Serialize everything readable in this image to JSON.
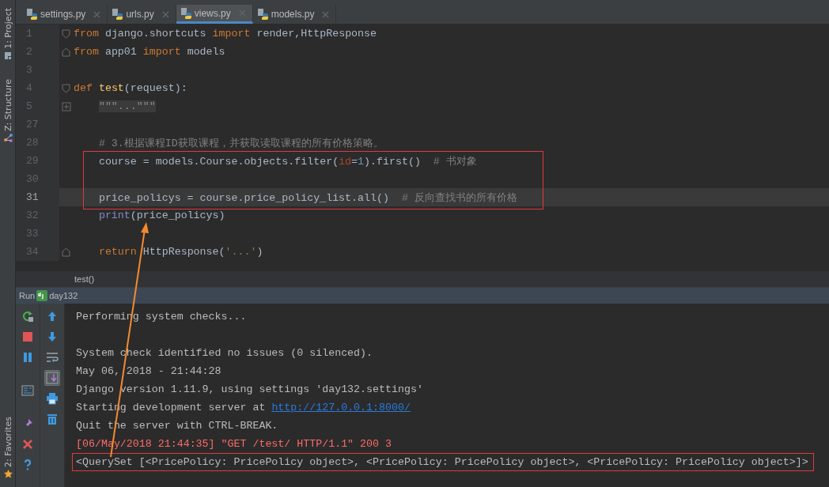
{
  "left_strip": [
    {
      "label": "1: Project",
      "kind": "project"
    },
    {
      "label": "Z: Structure",
      "kind": "structure"
    },
    {
      "label": "2: Favorites",
      "kind": "favorites"
    }
  ],
  "tabs": [
    {
      "label": "settings.py",
      "selected": false
    },
    {
      "label": "urls.py",
      "selected": false
    },
    {
      "label": "views.py",
      "selected": true
    },
    {
      "label": "models.py",
      "selected": false
    }
  ],
  "editor": {
    "lines": [
      {
        "number": "1",
        "kind": "fold-start",
        "tokens": [
          {
            "text": "from",
            "kind": "kw"
          },
          {
            "text": " django.shortcuts ",
            "kind": "plain"
          },
          {
            "text": "import",
            "kind": "kw"
          },
          {
            "text": " render,HttpResponse",
            "kind": "plain"
          }
        ]
      },
      {
        "number": "2",
        "kind": "fold-end",
        "tokens": [
          {
            "text": "from",
            "kind": "kw"
          },
          {
            "text": " app01 ",
            "kind": "plain"
          },
          {
            "text": "import",
            "kind": "kw"
          },
          {
            "text": " models",
            "kind": "plain"
          }
        ]
      },
      {
        "number": "3",
        "kind": "plain"
      },
      {
        "number": "4",
        "kind": "fold-start",
        "tokens": [
          {
            "text": "def",
            "kind": "kw"
          },
          {
            "text": " test",
            "kind": "fn"
          },
          {
            "text": "(request):",
            "kind": "plain"
          }
        ],
        "children": [
          {
            "number": "5",
            "kind": "folded",
            "tokens": [
              {
                "text": "\"\"\"...\"\"\"",
                "kind": "folded"
              }
            ]
          },
          {
            "number": "27",
            "kind": "plain"
          },
          {
            "number": "28",
            "kind": "plain",
            "tokens": [
              {
                "text": "# 3.根据课程ID获取课程，并获取读取课程的所有价格策略。",
                "kind": "comment"
              }
            ]
          },
          {
            "number": "29",
            "kind": "plain",
            "tokens": [
              {
                "text": "course = models.Course.objects.filter(",
                "kind": "plain"
              },
              {
                "text": "id",
                "kind": "param"
              },
              {
                "text": "=",
                "kind": "plain"
              },
              {
                "text": "1",
                "kind": "num"
              },
              {
                "text": ").first()  ",
                "kind": "plain"
              },
              {
                "text": "# 书对象",
                "kind": "comment"
              }
            ]
          },
          {
            "number": "30",
            "kind": "plain"
          },
          {
            "number": "31",
            "kind": "plain",
            "current": true,
            "tokens": [
              {
                "text": "price_policys = course.price_policy_list.all()  ",
                "kind": "plain"
              },
              {
                "text": "# 反向查找书的所有价格",
                "kind": "comment"
              }
            ]
          },
          {
            "number": "32",
            "kind": "plain",
            "tokens": [
              {
                "text": "print",
                "kind": "builtin"
              },
              {
                "text": "(price_policys)",
                "kind": "plain"
              }
            ]
          },
          {
            "number": "33",
            "kind": "plain"
          },
          {
            "number": "34",
            "kind": "fold-end",
            "tokens": [
              {
                "text": "return",
                "kind": "kw"
              },
              {
                "text": " HttpResponse(",
                "kind": "plain"
              },
              {
                "text": "'...'",
                "kind": "str"
              },
              {
                "text": ")",
                "kind": "plain"
              }
            ]
          }
        ]
      }
    ]
  },
  "breadcrumb": "test()",
  "run": {
    "label": "Run",
    "config": "day132",
    "tools_left": [
      {
        "kind": "rerun"
      },
      {
        "kind": "stop"
      },
      {
        "kind": "pause"
      },
      {
        "kind": "layout"
      },
      {
        "kind": "pin"
      },
      {
        "kind": "close"
      },
      {
        "kind": "help"
      }
    ],
    "tools_right": [
      {
        "kind": "up",
        "selected": false
      },
      {
        "kind": "down",
        "selected": false
      },
      {
        "kind": "wrap",
        "selected": false
      },
      {
        "kind": "scroll-end",
        "selected": true
      },
      {
        "kind": "print",
        "selected": false
      },
      {
        "kind": "trash",
        "selected": false
      }
    ],
    "console": [
      {
        "segments": [
          {
            "text": "Performing system checks...",
            "kind": "normal"
          }
        ]
      },
      {
        "spaced": true,
        "segments": [
          {
            "text": "System check identified no issues (0 silenced).",
            "kind": "normal"
          }
        ]
      },
      {
        "segments": [
          {
            "text": "May 06, 2018 - 21:44:28",
            "kind": "normal"
          }
        ]
      },
      {
        "segments": [
          {
            "text": "Django version 1.11.9, using settings 'day132.settings'",
            "kind": "normal"
          }
        ]
      },
      {
        "segments": [
          {
            "text": "Starting development server at ",
            "kind": "normal"
          },
          {
            "text": "http://127.0.0.1:8000/",
            "kind": "link"
          }
        ]
      },
      {
        "segments": [
          {
            "text": "Quit the server with CTRL-BREAK.",
            "kind": "normal"
          }
        ]
      },
      {
        "segments": [
          {
            "text": "[06/May/2018 21:44:35] \"GET /test/ HTTP/1.1\" 200 3",
            "kind": "error"
          }
        ]
      },
      {
        "segments": [
          {
            "text": "<QuerySet [<PricePolicy: PricePolicy object>, <PricePolicy: PricePolicy object>, <PricePolicy: PricePolicy object>]>",
            "kind": "normal"
          }
        ],
        "framed": true
      }
    ]
  }
}
